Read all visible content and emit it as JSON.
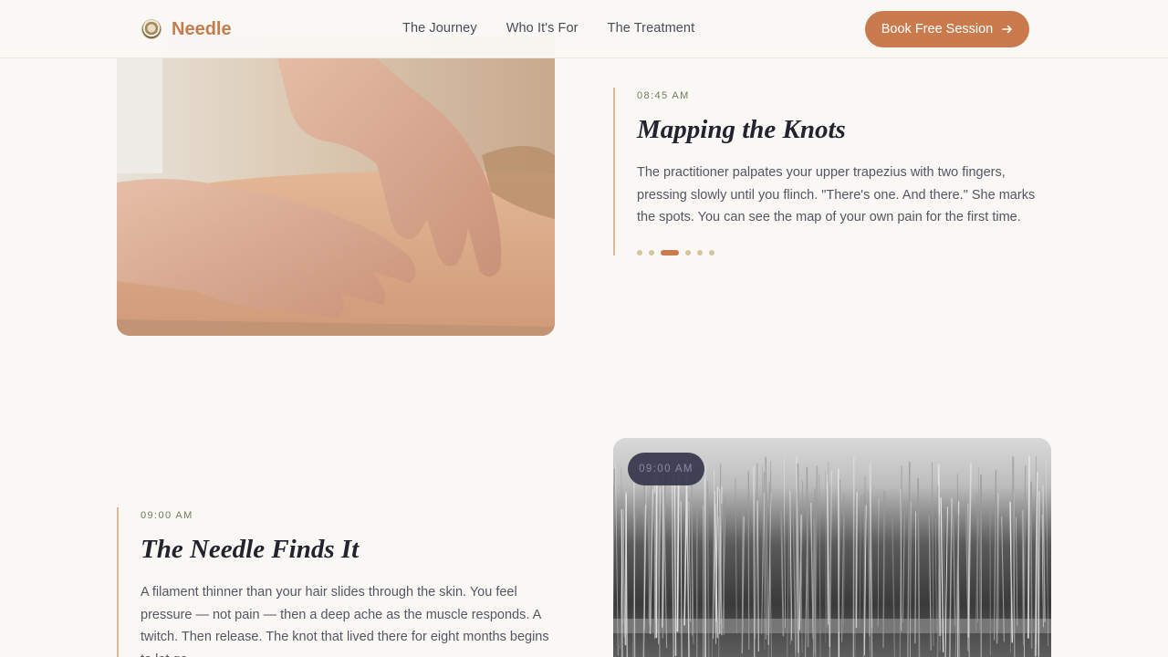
{
  "header": {
    "brand_name": "Needle",
    "nav": [
      "The Journey",
      "Who It's For",
      "The Treatment"
    ],
    "cta_label": "Book Free Session"
  },
  "steps": [
    {
      "time": "08:45 AM",
      "title": "Mapping the Knots",
      "body": "The practitioner palpates your upper trapezius with two fingers, pressing slowly until you flinch. \"There's one. And there.\" She marks the spots. You can see the map of your own pain for the first time.",
      "dots_total": 6,
      "dots_active_index": 2
    },
    {
      "time": "09:00 AM",
      "title": "The Needle Finds It",
      "body": "A filament thinner than your hair slides through the skin. You feel pressure — not pain — then a deep ache as the muscle responds. A twitch. Then release. The knot that lived there for eight months begins to let go.",
      "image_time": "09:00 AM"
    }
  ],
  "colors": {
    "accent": "#c97b4d",
    "background": "#faf8f5",
    "time_label": "#6e7a5a",
    "pill_bg": "#32324a"
  }
}
